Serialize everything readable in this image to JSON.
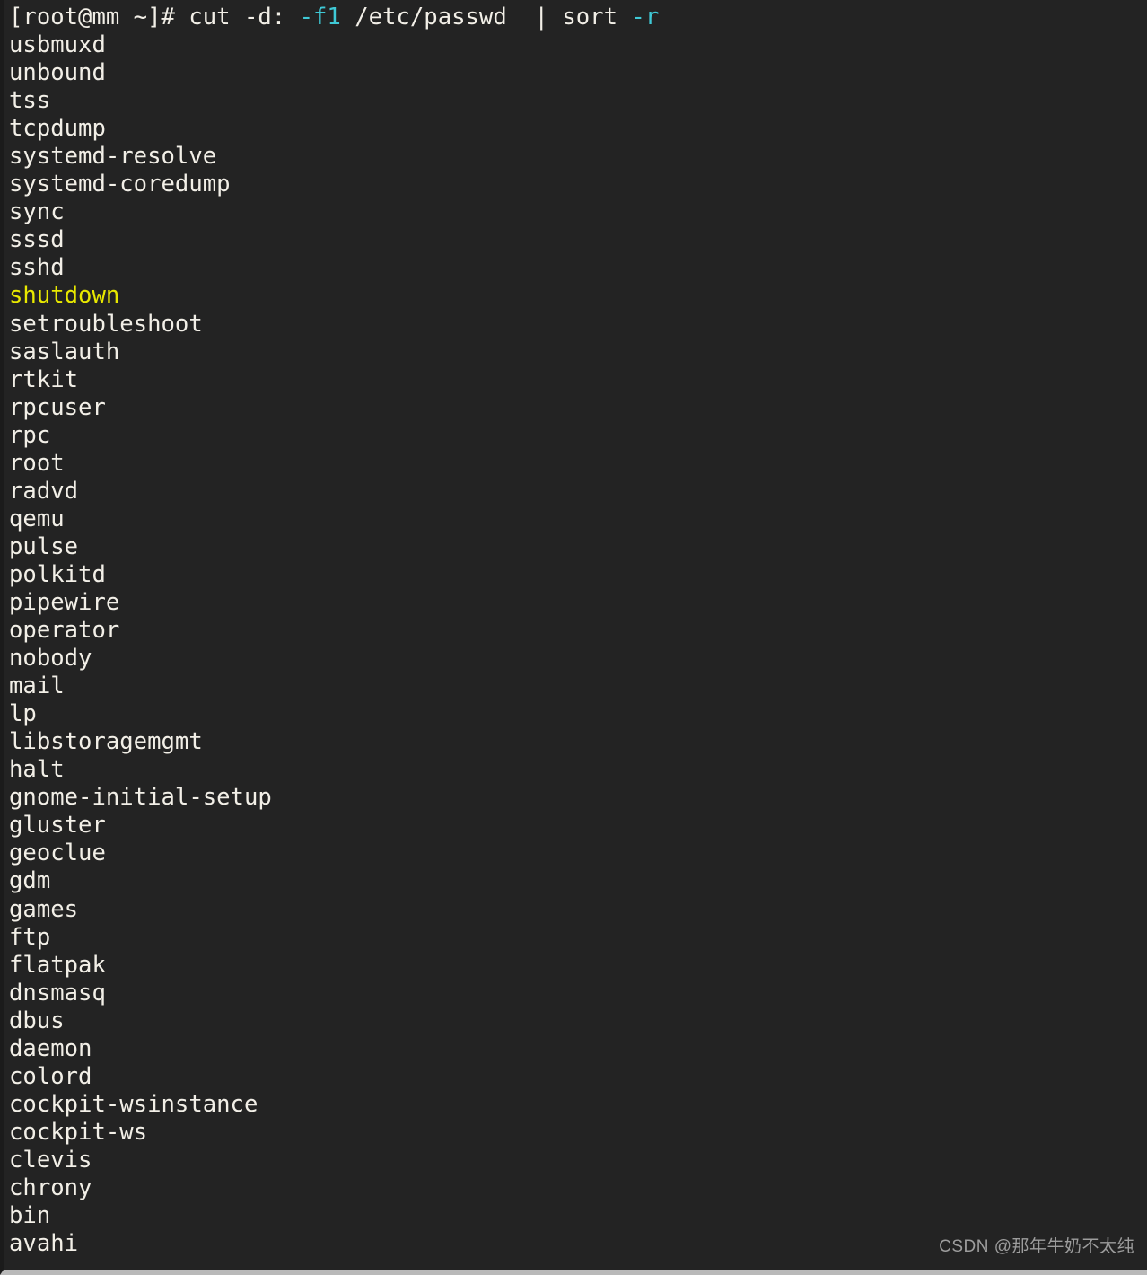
{
  "terminal": {
    "background_color": "#232323",
    "foreground_color": "#f2efe7",
    "accent_cyan": "#3fc9d6",
    "accent_yellow": "#e8e800",
    "prompt": {
      "user_host": "[root@mm ~]#",
      "command_parts": [
        {
          "text": " cut -d: ",
          "color": "plain"
        },
        {
          "text": "-f1",
          "color": "cyan"
        },
        {
          "text": " /etc/passwd  | sort ",
          "color": "plain"
        },
        {
          "text": "-r",
          "color": "cyan"
        }
      ],
      "full_command": "[root@mm ~]# cut -d: -f1 /etc/passwd  | sort -r"
    },
    "output_lines": [
      {
        "text": "usbmuxd",
        "color": "plain"
      },
      {
        "text": "unbound",
        "color": "plain"
      },
      {
        "text": "tss",
        "color": "plain"
      },
      {
        "text": "tcpdump",
        "color": "plain"
      },
      {
        "text": "systemd-resolve",
        "color": "plain"
      },
      {
        "text": "systemd-coredump",
        "color": "plain"
      },
      {
        "text": "sync",
        "color": "plain"
      },
      {
        "text": "sssd",
        "color": "plain"
      },
      {
        "text": "sshd",
        "color": "plain"
      },
      {
        "text": "shutdown",
        "color": "yellow"
      },
      {
        "text": "setroubleshoot",
        "color": "plain"
      },
      {
        "text": "saslauth",
        "color": "plain"
      },
      {
        "text": "rtkit",
        "color": "plain"
      },
      {
        "text": "rpcuser",
        "color": "plain"
      },
      {
        "text": "rpc",
        "color": "plain"
      },
      {
        "text": "root",
        "color": "plain"
      },
      {
        "text": "radvd",
        "color": "plain"
      },
      {
        "text": "qemu",
        "color": "plain"
      },
      {
        "text": "pulse",
        "color": "plain"
      },
      {
        "text": "polkitd",
        "color": "plain"
      },
      {
        "text": "pipewire",
        "color": "plain"
      },
      {
        "text": "operator",
        "color": "plain"
      },
      {
        "text": "nobody",
        "color": "plain"
      },
      {
        "text": "mail",
        "color": "plain"
      },
      {
        "text": "lp",
        "color": "plain"
      },
      {
        "text": "libstoragemgmt",
        "color": "plain"
      },
      {
        "text": "halt",
        "color": "plain"
      },
      {
        "text": "gnome-initial-setup",
        "color": "plain"
      },
      {
        "text": "gluster",
        "color": "plain"
      },
      {
        "text": "geoclue",
        "color": "plain"
      },
      {
        "text": "gdm",
        "color": "plain"
      },
      {
        "text": "games",
        "color": "plain"
      },
      {
        "text": "ftp",
        "color": "plain"
      },
      {
        "text": "flatpak",
        "color": "plain"
      },
      {
        "text": "dnsmasq",
        "color": "plain"
      },
      {
        "text": "dbus",
        "color": "plain"
      },
      {
        "text": "daemon",
        "color": "plain"
      },
      {
        "text": "colord",
        "color": "plain"
      },
      {
        "text": "cockpit-wsinstance",
        "color": "plain"
      },
      {
        "text": "cockpit-ws",
        "color": "plain"
      },
      {
        "text": "clevis",
        "color": "plain"
      },
      {
        "text": "chrony",
        "color": "plain"
      },
      {
        "text": "bin",
        "color": "plain"
      },
      {
        "text": "avahi",
        "color": "plain"
      }
    ]
  },
  "watermark": {
    "text": "CSDN @那年牛奶不太纯"
  }
}
